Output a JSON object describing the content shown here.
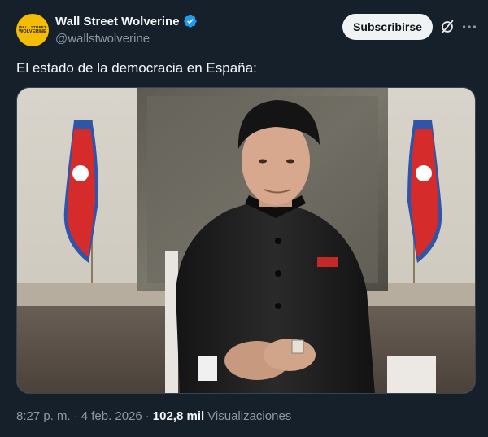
{
  "author": {
    "display_name": "Wall Street Wolverine",
    "handle": "@wallstwolverine",
    "avatar_text_line1": "WALL STREET",
    "avatar_text_line2": "WOLVERINE",
    "avatar_color": "#f5bd02",
    "verified_color": "#1d9bf0"
  },
  "actions": {
    "subscribe_label": "Subscribirse",
    "grok_icon": "grok-icon",
    "more_icon": "more-icon"
  },
  "tweet": {
    "text": "El estado de la democracia en España:"
  },
  "meta": {
    "time": "8:27 p. m.",
    "separator1": "·",
    "date": "4 feb. 2026",
    "separator2": "·",
    "views_count": "102,8 mil",
    "views_label": "Visualizaciones"
  },
  "colors": {
    "background": "#15202b",
    "secondary_text": "#8b98a5"
  }
}
